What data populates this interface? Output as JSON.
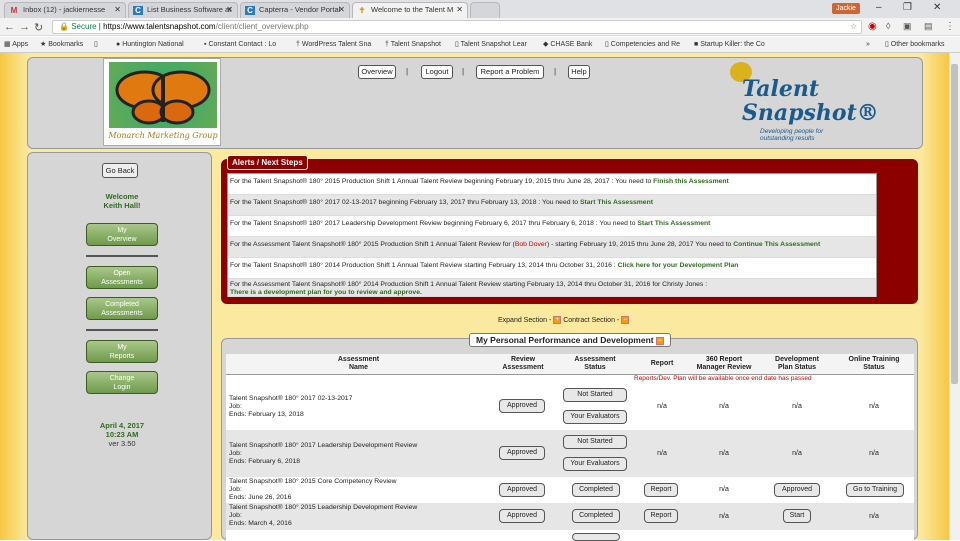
{
  "browser": {
    "tabs": [
      {
        "label": "Inbox (12) - jackiernesse",
        "icon": "gmail-icon",
        "glyph": "M"
      },
      {
        "label": "List Business Software at",
        "icon": "capterra-icon",
        "glyph": "C"
      },
      {
        "label": "Capterra - Vendor Portal",
        "icon": "capterra-icon",
        "glyph": "C"
      },
      {
        "label": "Welcome to the Talent M",
        "icon": "talent-icon",
        "glyph": "✝"
      }
    ],
    "user_badge": "Jackie",
    "address": {
      "secure": "Secure",
      "domain": "https://www.talentsnapshot.com",
      "path": "/client/client_overview.php"
    },
    "bookmarks": [
      "Apps",
      "Bookmarks",
      "Huntington National",
      "Constant Contact : Lo",
      "WordPress Talent Sna",
      "Talent Snapshot",
      "Talent Snapshot Lear",
      "CHASE Bank",
      "Competencies and Re",
      "Startup Killer: the Co",
      "»",
      "Other bookmarks"
    ]
  },
  "header": {
    "logo_caption": "Monarch Marketing Group",
    "nav": [
      "Overview",
      "Logout",
      "Report a Problem",
      "Help"
    ],
    "brand_line1": "Talent",
    "brand_line2": "Snapshot®",
    "brand_sub1": "Developing people for",
    "brand_sub2": "outstanding results"
  },
  "sidebar": {
    "go_back": "Go Back",
    "welcome": "Welcome",
    "user": "Keith Hall!",
    "btn_overview": [
      "My",
      "Overview"
    ],
    "btn_open": [
      "Open",
      "Assessments"
    ],
    "btn_completed": [
      "Completed",
      "Assessments"
    ],
    "btn_reports": [
      "My",
      "Reports"
    ],
    "btn_login": [
      "Change",
      "Login"
    ],
    "date": "April 4, 2017",
    "time": "10:23 AM",
    "version": "ver 3.50"
  },
  "alerts": {
    "title": "Alerts / Next Steps",
    "rows": [
      {
        "pre": "For the Talent Snapshot® 180° 2015 Production Shift 1 Annual Talent Review beginning February 19, 2015 thru June 28, 2017 : You need to ",
        "link": "Finish this Assessment",
        "post": ""
      },
      {
        "pre": "For the Talent Snapshot® 180° 2017 02-13-2017 beginning February 13, 2017 thru February 13, 2018 : You need to ",
        "link": "Start This Assessment",
        "post": ""
      },
      {
        "pre": "For the Talent Snapshot® 180° 2017 Leadership Development Review beginning February 6, 2017 thru February 6, 2018 : You need to ",
        "link": "Start This Assessment",
        "post": ""
      },
      {
        "pre": "For the Assessment Talent Snapshot® 180° 2015 Production Shift 1 Annual Talent Review for (",
        "red": "Bob Dover",
        "mid": ") - starting February 19, 2015 thru June 28, 2017 You need to ",
        "link": "Continue This Assessment"
      },
      {
        "pre": "For the Talent Snapshot® 180° 2014 Production Shift 1 Annual Talent Review starting February 13, 2014 thru October 31, 2016 : ",
        "link": "Click here for your Development Plan",
        "post": ""
      },
      {
        "pre": "For the Assessment Talent Snapshot® 180° 2014 Production Shift 1 Annual Talent Review starting February 13, 2014 thru October 31, 2016 for Christy Jones :",
        "link": "There is a development plan for you to review and approve.",
        "post": ""
      }
    ]
  },
  "section": {
    "expand": "Expand Section -",
    "contract": "Contract Section -",
    "title": "My Personal Performance and Development"
  },
  "table": {
    "headers": [
      [
        "Assessment",
        "Name"
      ],
      [
        "Review",
        "Assessment"
      ],
      [
        "Assessment",
        "Status"
      ],
      [
        "Report",
        ""
      ],
      [
        "360 Report",
        "Manager Review"
      ],
      [
        "Development",
        "Plan Status"
      ],
      [
        "Online Training",
        "Status"
      ]
    ],
    "note": "Reports/Dev. Plan will be available once end date has passed",
    "rows": [
      {
        "name": "Talent Snapshot® 180° 2017 02-13-2017",
        "job": "Job:",
        "ends": "Ends: February 13, 2018",
        "review": "Approved",
        "status": "Not Started",
        "status2": "Your Evaluators",
        "report": "n/a",
        "mgr": "n/a",
        "dev": "n/a",
        "train": "n/a"
      },
      {
        "name": "Talent Snapshot® 180° 2017 Leadership Development Review",
        "job": "Job:",
        "ends": "Ends: February 6, 2018",
        "review": "Approved",
        "status": "Not Started",
        "status2": "Your Evaluators",
        "report": "n/a",
        "mgr": "n/a",
        "dev": "n/a",
        "train": "n/a"
      },
      {
        "name": "Talent Snapshot® 180° 2015 Core Competency Review",
        "job": "Job:",
        "ends": "Ends: June 26, 2016",
        "review": "Approved",
        "status": "Completed",
        "report": "Report",
        "mgr": "n/a",
        "dev": "Approved",
        "train": "Go to Training"
      },
      {
        "name": "Talent Snapshot® 180° 2015 Leadership Development Review",
        "job": "Job:",
        "ends": "Ends: March 4, 2016",
        "review": "Approved",
        "status": "Completed",
        "report": "Report",
        "mgr": "n/a",
        "dev": "Start",
        "train": "n/a"
      }
    ]
  }
}
